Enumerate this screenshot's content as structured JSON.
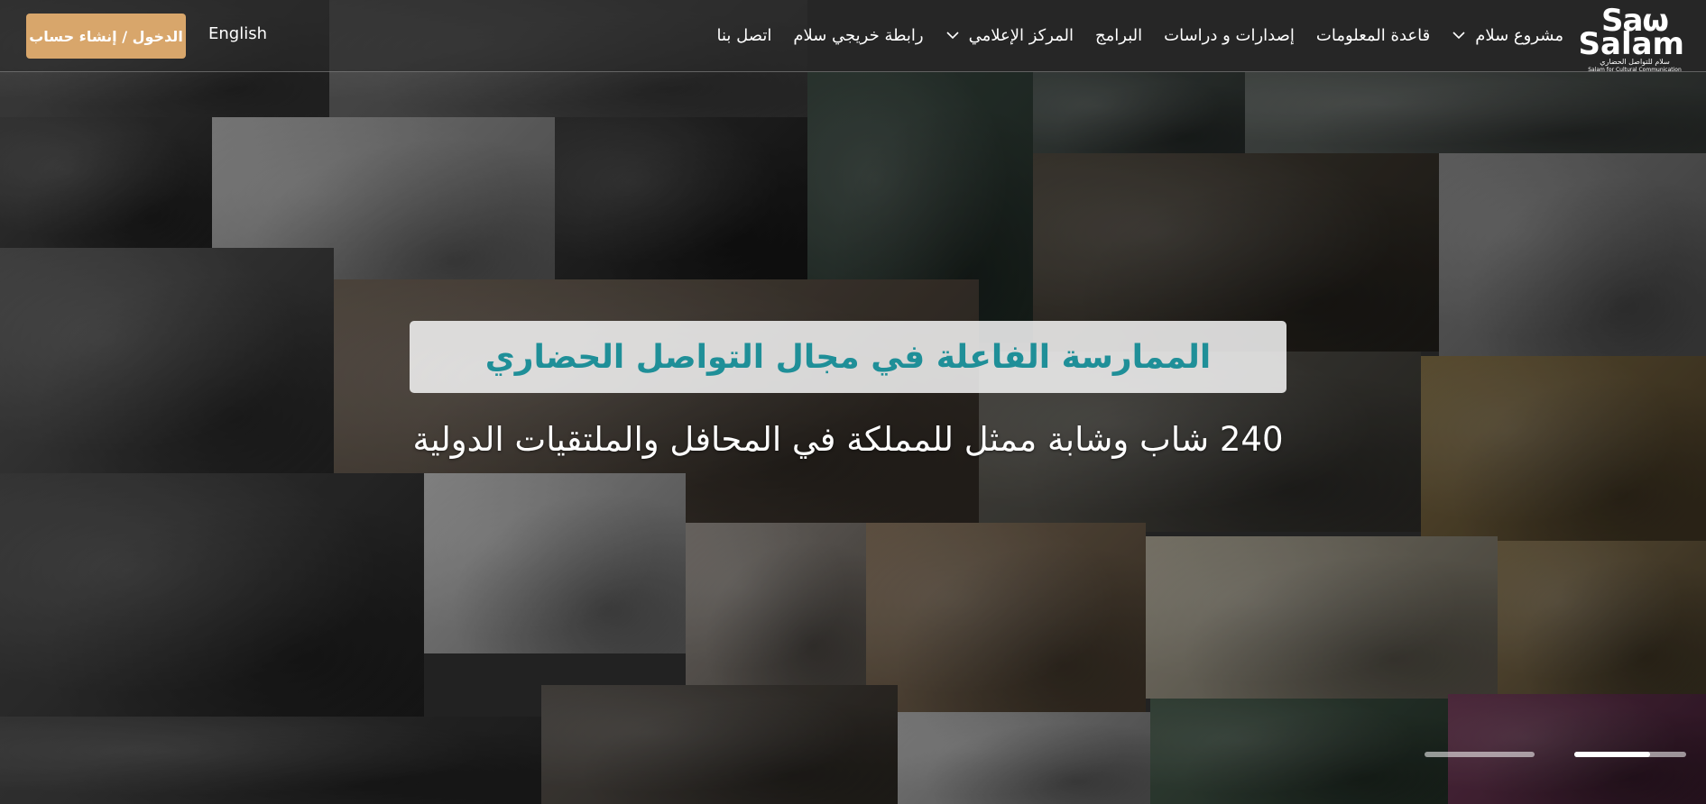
{
  "header": {
    "logo": {
      "mark_top": "Saω",
      "mark_bottom": "Salam",
      "tagline_ar": "سلام للتواصل الحضاري",
      "tagline_en": "Salam for Cultural Communication"
    },
    "nav": [
      {
        "label": "مشروع سلام",
        "has_dropdown": true
      },
      {
        "label": "قاعدة المعلومات",
        "has_dropdown": false
      },
      {
        "label": "إصدارات و دراسات",
        "has_dropdown": false
      },
      {
        "label": "البرامج",
        "has_dropdown": false
      },
      {
        "label": "المركز الإعلامي",
        "has_dropdown": true
      },
      {
        "label": "رابطة خريجي سلام",
        "has_dropdown": false
      },
      {
        "label": "اتصل بنا",
        "has_dropdown": false
      }
    ],
    "language_switch": "English",
    "login_button": "الدخول / إنشاء حساب"
  },
  "hero": {
    "title": "الممارسة الفاعلة في مجال التواصل الحضاري",
    "subtitle": "240 شاب وشابة ممثل للمملكة في المحافل والملتقيات الدولية"
  },
  "slider": {
    "slide_count": 2,
    "active_index": 2,
    "active_progress": 0.68
  },
  "colors": {
    "accent_button": "#d8a66b",
    "hero_title": "#1f8f98",
    "header_bg": "#3a3a3a"
  }
}
